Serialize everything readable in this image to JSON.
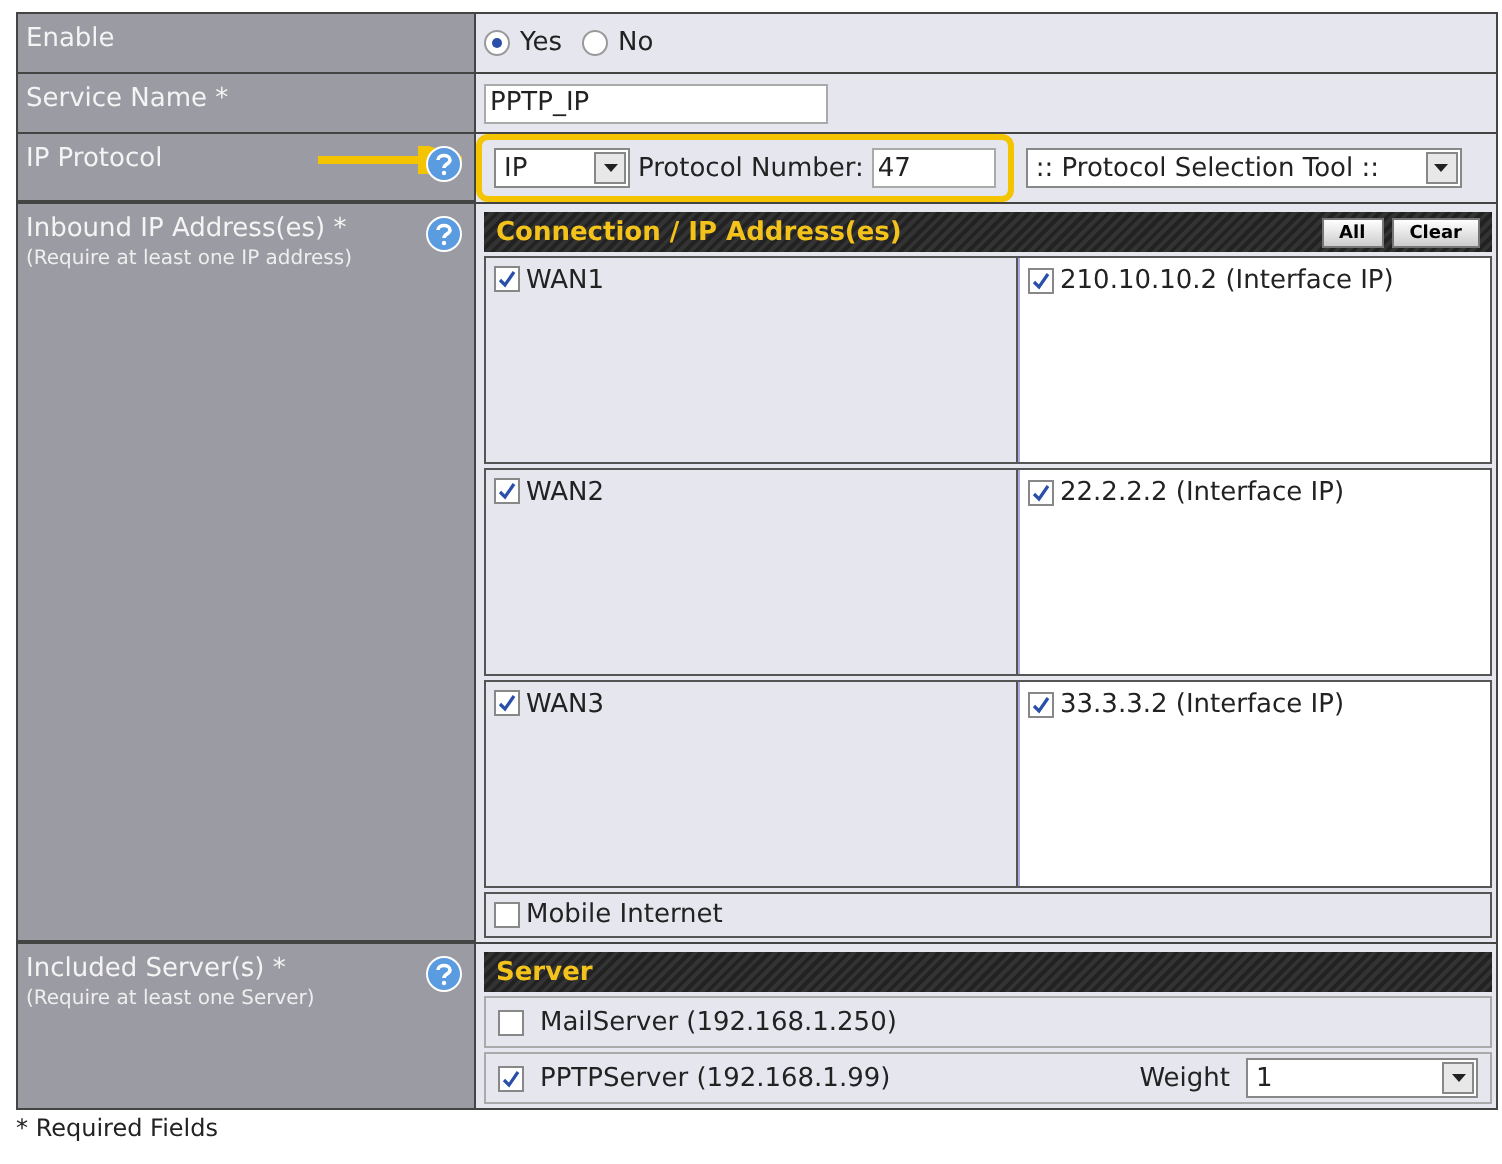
{
  "enable": {
    "label": "Enable",
    "options": [
      {
        "label": "Yes",
        "selected": true
      },
      {
        "label": "No",
        "selected": false
      }
    ]
  },
  "service_name": {
    "label": "Service Name *",
    "value": "PPTP_IP"
  },
  "ip_protocol": {
    "label": "IP Protocol",
    "protocol": "IP",
    "number_label": "Protocol Number:",
    "number": "47",
    "tool": ":: Protocol Selection Tool ::",
    "highlighted": true
  },
  "inbound": {
    "label": "Inbound IP Address(es) *",
    "note": "(Require at least one IP address)",
    "header": "Connection / IP Address(es)",
    "buttons": [
      "All",
      "Clear"
    ],
    "connections": [
      {
        "name": "WAN1",
        "checked": true,
        "addresses": [
          {
            "label": "210.10.10.2 (Interface IP)",
            "checked": true
          }
        ]
      },
      {
        "name": "WAN2",
        "checked": true,
        "addresses": [
          {
            "label": "22.2.2.2 (Interface IP)",
            "checked": true
          }
        ]
      },
      {
        "name": "WAN3",
        "checked": true,
        "addresses": [
          {
            "label": "33.3.3.2 (Interface IP)",
            "checked": true
          }
        ]
      }
    ],
    "extra": {
      "name": "Mobile Internet",
      "checked": false
    }
  },
  "servers": {
    "label": "Included Server(s) *",
    "note": "(Require at least one Server)",
    "header": "Server",
    "items": [
      {
        "name": "MailServer (192.168.1.250)",
        "checked": false
      },
      {
        "name": "PPTPServer (192.168.1.99)",
        "checked": true,
        "weight_label": "Weight",
        "weight": "1"
      }
    ]
  },
  "footer": "* Required Fields"
}
